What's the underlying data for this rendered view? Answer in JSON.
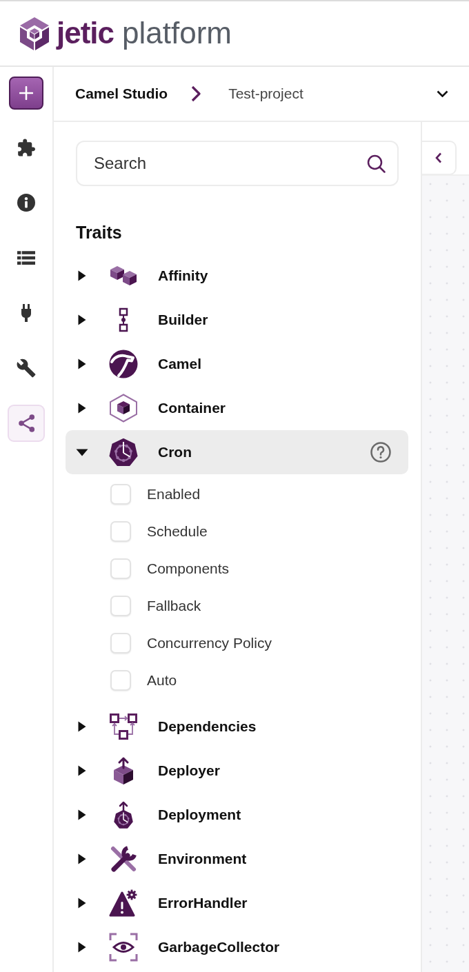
{
  "header": {
    "brand": "jetic",
    "product": "platform"
  },
  "rail": {
    "items": [
      {
        "kind": "puzzle",
        "selected": false
      },
      {
        "kind": "info",
        "selected": false
      },
      {
        "kind": "list",
        "selected": false
      },
      {
        "kind": "plug",
        "selected": false
      },
      {
        "kind": "wrench",
        "selected": false
      },
      {
        "kind": "share",
        "selected": true
      }
    ]
  },
  "breadcrumb": {
    "studio": "Camel Studio",
    "project": "Test-project"
  },
  "search": {
    "placeholder": "Search"
  },
  "traits": {
    "title": "Traits",
    "items": [
      {
        "label": "Affinity",
        "kind": "affinity",
        "expanded": false,
        "selected": false
      },
      {
        "label": "Builder",
        "kind": "builder",
        "expanded": false,
        "selected": false
      },
      {
        "label": "Camel",
        "kind": "camel",
        "expanded": false,
        "selected": false
      },
      {
        "label": "Container",
        "kind": "container",
        "expanded": false,
        "selected": false
      },
      {
        "label": "Cron",
        "kind": "cron",
        "expanded": true,
        "selected": true,
        "children": [
          {
            "label": "Enabled",
            "checked": false
          },
          {
            "label": "Schedule",
            "checked": false
          },
          {
            "label": "Components",
            "checked": false
          },
          {
            "label": "Fallback",
            "checked": false
          },
          {
            "label": "Concurrency Policy",
            "checked": false
          },
          {
            "label": "Auto",
            "checked": false
          }
        ]
      },
      {
        "label": "Dependencies",
        "kind": "dependencies",
        "expanded": false,
        "selected": false
      },
      {
        "label": "Deployer",
        "kind": "deployer",
        "expanded": false,
        "selected": false
      },
      {
        "label": "Deployment",
        "kind": "deployment",
        "expanded": false,
        "selected": false
      },
      {
        "label": "Environment",
        "kind": "environment",
        "expanded": false,
        "selected": false
      },
      {
        "label": "ErrorHandler",
        "kind": "errorhandler",
        "expanded": false,
        "selected": false
      },
      {
        "label": "GarbageCollector",
        "kind": "garbagecollector",
        "expanded": false,
        "selected": false
      }
    ]
  }
}
